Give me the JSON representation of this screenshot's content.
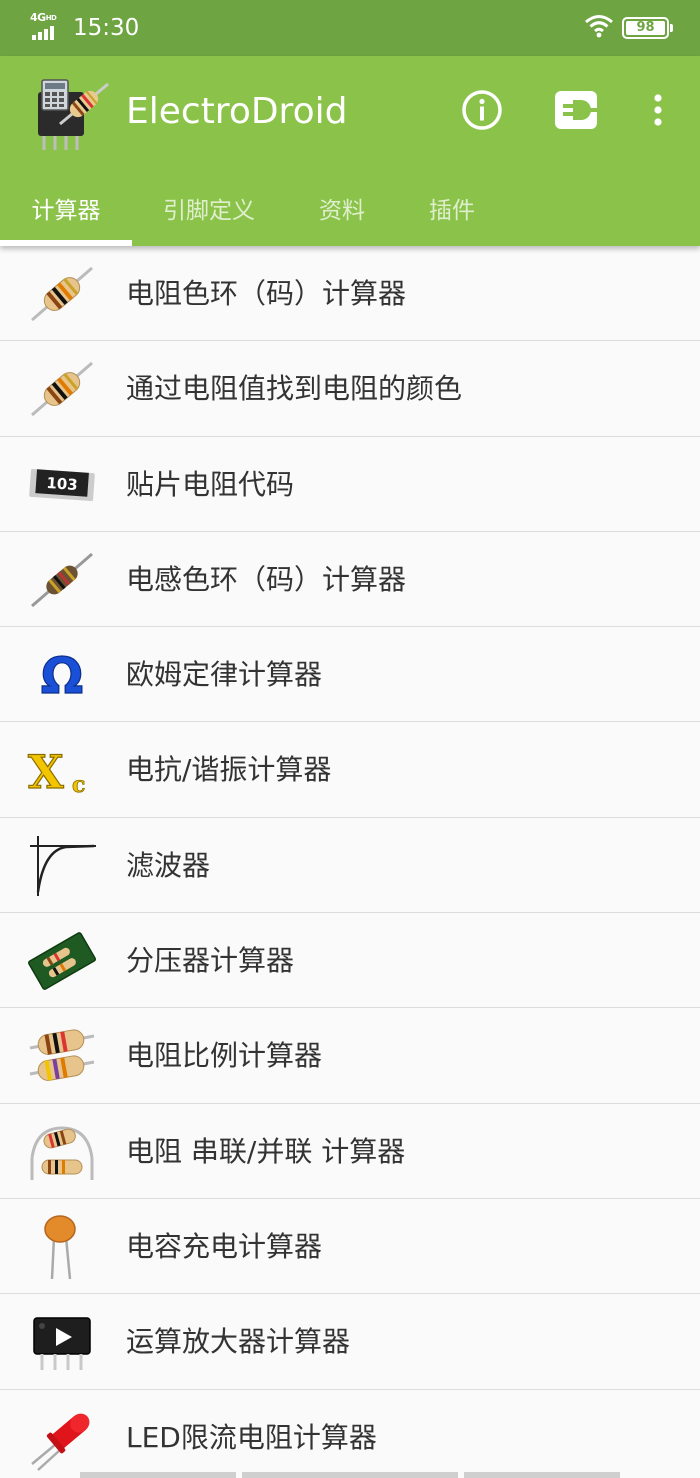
{
  "status_bar": {
    "network": "4G",
    "network_sup": "HD",
    "time": "15:30",
    "battery": "98"
  },
  "app": {
    "title": "ElectroDroid",
    "logo_icon": "ic-chip-resistor-logo",
    "actions": {
      "info_icon": "info-icon",
      "plugin_icon": "plugin-icon",
      "more_icon": "more-vert-icon"
    }
  },
  "tabs": [
    {
      "label": "计算器",
      "active": true
    },
    {
      "label": "引脚定义",
      "active": false
    },
    {
      "label": "资料",
      "active": false
    },
    {
      "label": "插件",
      "active": false
    }
  ],
  "items": [
    {
      "label": "电阻色环（码）计算器",
      "icon": "resistor-icon"
    },
    {
      "label": "通过电阻值找到电阻的颜色",
      "icon": "resistor-icon"
    },
    {
      "label": "贴片电阻代码",
      "icon": "smd-resistor-icon",
      "icon_text": "103"
    },
    {
      "label": "电感色环（码）计算器",
      "icon": "inductor-icon"
    },
    {
      "label": "欧姆定律计算器",
      "icon": "ohm-icon",
      "icon_text": "Ω"
    },
    {
      "label": "电抗/谐振计算器",
      "icon": "reactance-icon",
      "icon_text": "X",
      "icon_sub": "c"
    },
    {
      "label": "滤波器",
      "icon": "filter-curve-icon"
    },
    {
      "label": "分压器计算器",
      "icon": "voltage-divider-icon"
    },
    {
      "label": "电阻比例计算器",
      "icon": "resistor-ratio-icon"
    },
    {
      "label": "电阻 串联/并联 计算器",
      "icon": "resistor-series-parallel-icon"
    },
    {
      "label": "电容充电计算器",
      "icon": "capacitor-icon"
    },
    {
      "label": "运算放大器计算器",
      "icon": "opamp-icon"
    },
    {
      "label": "LED限流电阻计算器",
      "icon": "led-icon"
    }
  ],
  "colors": {
    "status_bar": "#6ea542",
    "app_bar": "#8bc34a",
    "list_bg": "#fafafa",
    "divider": "#dcdcdc",
    "text": "#333333"
  }
}
